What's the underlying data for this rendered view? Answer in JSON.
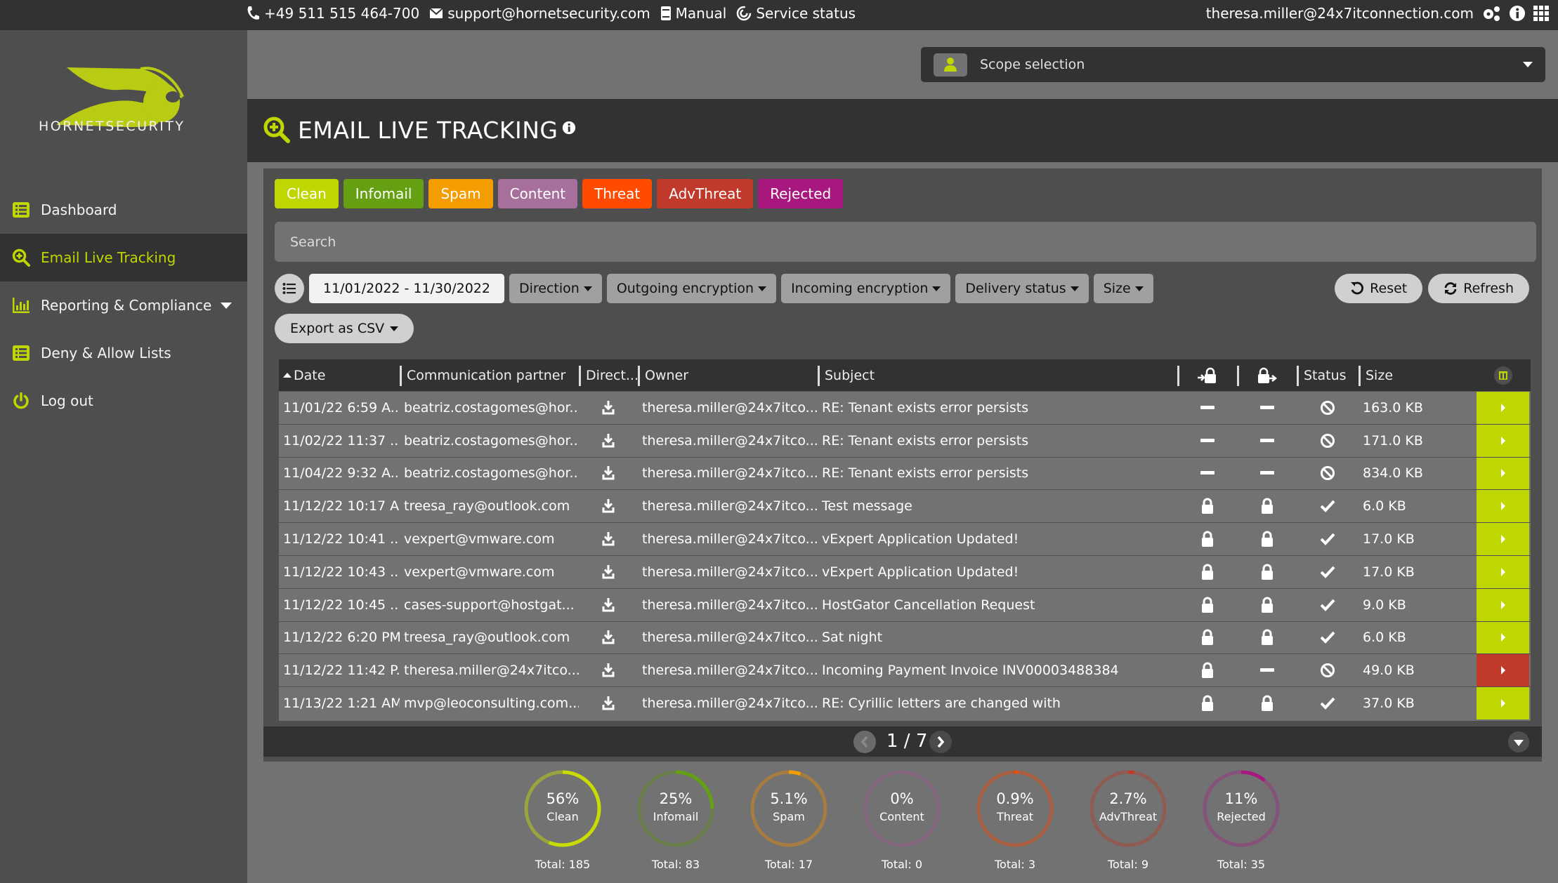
{
  "topbar": {
    "phone": "+49 511 515 464-700",
    "email": "support@hornetsecurity.com",
    "manual": "Manual",
    "service_status": "Service status",
    "user": "theresa.miller@24x7itconnection.com"
  },
  "sidebar": {
    "brand": "HORNETSECURITY",
    "items": [
      {
        "label": "Dashboard",
        "icon": "list-icon"
      },
      {
        "label": "Email Live Tracking",
        "icon": "search-plus-icon",
        "active": true
      },
      {
        "label": "Reporting & Compliance",
        "icon": "bar-chart-icon",
        "has_submenu": true
      },
      {
        "label": "Deny & Allow Lists",
        "icon": "list-icon"
      },
      {
        "label": "Log out",
        "icon": "power-icon"
      }
    ]
  },
  "scope": {
    "label": "Scope selection"
  },
  "page": {
    "title": "EMAIL LIVE TRACKING"
  },
  "categories": [
    {
      "label": "Clean",
      "color": "#bfd600"
    },
    {
      "label": "Infomail",
      "color": "#64a012"
    },
    {
      "label": "Spam",
      "color": "#f59c00"
    },
    {
      "label": "Content",
      "color": "#a66f9c"
    },
    {
      "label": "Threat",
      "color": "#ff4a00"
    },
    {
      "label": "AdvThreat",
      "color": "#c0392b"
    },
    {
      "label": "Rejected",
      "color": "#a8177e"
    }
  ],
  "search": {
    "placeholder": "Search",
    "value": ""
  },
  "filters": {
    "date_range": "11/01/2022 - 11/30/2022",
    "direction": "Direction",
    "outgoing_encryption": "Outgoing encryption",
    "incoming_encryption": "Incoming encryption",
    "delivery_status": "Delivery status",
    "size": "Size",
    "reset": "Reset",
    "refresh": "Refresh",
    "export": "Export as CSV"
  },
  "table": {
    "columns": {
      "date": "Date",
      "partner": "Communication partner",
      "direction": "Direct...",
      "owner": "Owner",
      "subject": "Subject",
      "status": "Status",
      "size": "Size"
    },
    "rows": [
      {
        "date": "11/01/22 6:59 A...",
        "partner": "beatriz.costagomes@hor...",
        "owner": "theresa.miller@24x7itco...",
        "subject": "RE: Tenant exists error persists",
        "enc_in": "none",
        "enc_out": "none",
        "status": "blocked",
        "size": "163.0 KB",
        "category": "clean"
      },
      {
        "date": "11/02/22 11:37 ...",
        "partner": "beatriz.costagomes@hor...",
        "owner": "theresa.miller@24x7itco...",
        "subject": "RE: Tenant exists error persists",
        "enc_in": "none",
        "enc_out": "none",
        "status": "blocked",
        "size": "171.0 KB",
        "category": "clean"
      },
      {
        "date": "11/04/22 9:32 A...",
        "partner": "beatriz.costagomes@hor...",
        "owner": "theresa.miller@24x7itco...",
        "subject": "RE: Tenant exists error persists",
        "enc_in": "none",
        "enc_out": "none",
        "status": "blocked",
        "size": "834.0 KB",
        "category": "clean"
      },
      {
        "date": "11/12/22 10:17 A...",
        "partner": "treesa_ray@outlook.com",
        "owner": "theresa.miller@24x7itco...",
        "subject": "Test message",
        "enc_in": "lock",
        "enc_out": "lock",
        "status": "delivered",
        "size": "6.0 KB",
        "category": "clean"
      },
      {
        "date": "11/12/22 10:41 ...",
        "partner": "vexpert@vmware.com",
        "owner": "theresa.miller@24x7itco...",
        "subject": "vExpert Application Updated!",
        "enc_in": "lock",
        "enc_out": "lock",
        "status": "delivered",
        "size": "17.0 KB",
        "category": "clean"
      },
      {
        "date": "11/12/22 10:43 ...",
        "partner": "vexpert@vmware.com",
        "owner": "theresa.miller@24x7itco...",
        "subject": "vExpert Application Updated!",
        "enc_in": "lock",
        "enc_out": "lock",
        "status": "delivered",
        "size": "17.0 KB",
        "category": "clean"
      },
      {
        "date": "11/12/22 10:45 ...",
        "partner": "cases-support@hostgat...",
        "owner": "theresa.miller@24x7itco...",
        "subject": "HostGator Cancellation Request",
        "enc_in": "lock",
        "enc_out": "lock",
        "status": "delivered",
        "size": "9.0 KB",
        "category": "clean"
      },
      {
        "date": "11/12/22 6:20 PM",
        "partner": "treesa_ray@outlook.com",
        "owner": "theresa.miller@24x7itco...",
        "subject": "Sat night",
        "enc_in": "lock",
        "enc_out": "lock",
        "status": "delivered",
        "size": "6.0 KB",
        "category": "clean"
      },
      {
        "date": "11/12/22 11:42 P...",
        "partner": "theresa.miller@24x7itco...",
        "owner": "theresa.miller@24x7itco...",
        "subject": "Incoming Payment Invoice INV00003488384",
        "enc_in": "lock",
        "enc_out": "none",
        "status": "blocked",
        "size": "49.0 KB",
        "category": "advthreat"
      },
      {
        "date": "11/13/22 1:21 AM",
        "partner": "mvp@leoconsulting.com...",
        "owner": "theresa.miller@24x7itco...",
        "subject": "RE: Cyrillic letters are changed with",
        "enc_in": "lock",
        "enc_out": "lock",
        "status": "delivered",
        "size": "37.0 KB",
        "category": "clean"
      }
    ]
  },
  "pagination": {
    "current": "1 / 7"
  },
  "stats": [
    {
      "pct": "56%",
      "fraction": 0.56,
      "label": "Clean",
      "total": "Total: 185",
      "color": "#c8dc00",
      "track": "#9aa43e"
    },
    {
      "pct": "25%",
      "fraction": 0.25,
      "label": "Infomail",
      "total": "Total: 83",
      "color": "#64a012",
      "track": "#6b7f4a"
    },
    {
      "pct": "5.1%",
      "fraction": 0.051,
      "label": "Spam",
      "total": "Total: 17",
      "color": "#f59c00",
      "track": "#a67c41"
    },
    {
      "pct": "0%",
      "fraction": 0,
      "label": "Content",
      "total": "Total: 0",
      "color": "#a66f9c",
      "track": "#83667e"
    },
    {
      "pct": "0.9%",
      "fraction": 0.009,
      "label": "Threat",
      "total": "Total: 3",
      "color": "#ff4a00",
      "track": "#a85e3f"
    },
    {
      "pct": "2.7%",
      "fraction": 0.027,
      "label": "AdvThreat",
      "total": "Total: 9",
      "color": "#c0392b",
      "track": "#8f5b52"
    },
    {
      "pct": "11%",
      "fraction": 0.11,
      "label": "Rejected",
      "total": "Total: 35",
      "color": "#a8177e",
      "track": "#86527a"
    }
  ],
  "colors": {
    "accent": "#bfd600",
    "row_clean": "#bfd600",
    "row_advthreat": "#c0392b"
  }
}
